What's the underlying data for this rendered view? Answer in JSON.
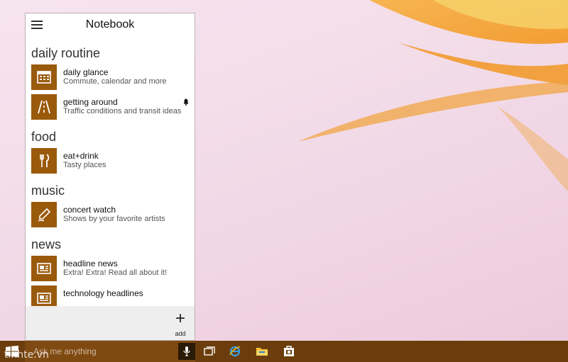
{
  "panel": {
    "title": "Notebook"
  },
  "sections": [
    {
      "name": "daily routine",
      "items": [
        {
          "title": "daily glance",
          "subtitle": "Commute, calendar and more",
          "icon": "calendar-icon"
        },
        {
          "title": "getting around",
          "subtitle": "Traffic conditions and transit ideas",
          "icon": "road-icon",
          "notification": "bell-icon"
        }
      ]
    },
    {
      "name": "food",
      "items": [
        {
          "title": "eat+drink",
          "subtitle": "Tasty places",
          "icon": "fork-knife-icon"
        }
      ]
    },
    {
      "name": "music",
      "items": [
        {
          "title": "concert watch",
          "subtitle": "Shows by your favorite artists",
          "icon": "pen-icon"
        }
      ]
    },
    {
      "name": "news",
      "items": [
        {
          "title": "headline news",
          "subtitle": "Extra! Extra! Read all about it!",
          "icon": "newspaper-icon"
        },
        {
          "title": "technology headlines",
          "subtitle": "",
          "icon": "newspaper-icon"
        }
      ]
    }
  ],
  "bottom": {
    "add_label": "add"
  },
  "taskbar": {
    "search_placeholder": "Ask me anything",
    "watermark": "tinhte.vn"
  },
  "colors": {
    "accent": "#9a5a0c",
    "taskbar": "#6b3d0c"
  }
}
